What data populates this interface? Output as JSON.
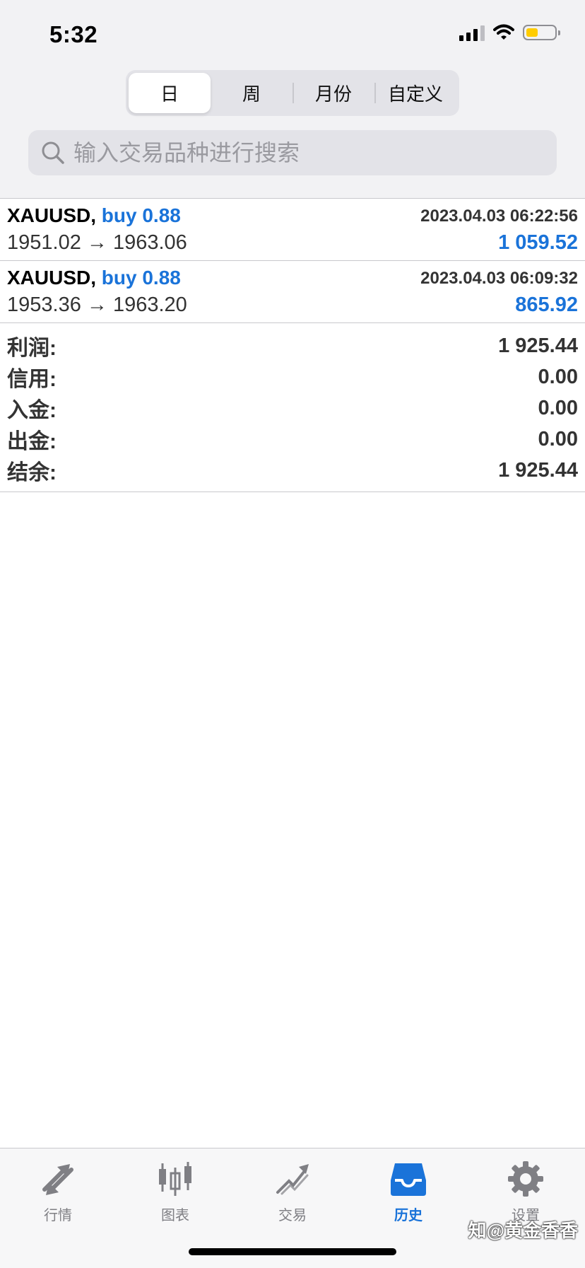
{
  "status_bar": {
    "time": "5:32"
  },
  "segments": [
    {
      "label": "日",
      "active": true
    },
    {
      "label": "周",
      "active": false
    },
    {
      "label": "月份",
      "active": false
    },
    {
      "label": "自定义",
      "active": false
    }
  ],
  "search": {
    "placeholder": "输入交易品种进行搜索"
  },
  "trades": [
    {
      "symbol": "XAUUSD,",
      "direction": "buy 0.88",
      "timestamp": "2023.04.03 06:22:56",
      "prices": "1951.02 → 1963.06",
      "profit": "1 059.52"
    },
    {
      "symbol": "XAUUSD,",
      "direction": "buy 0.88",
      "timestamp": "2023.04.03 06:09:32",
      "prices": "1953.36 → 1963.20",
      "profit": "865.92"
    }
  ],
  "summary": {
    "profit": {
      "label": "利润:",
      "value": "1 925.44"
    },
    "credit": {
      "label": "信用:",
      "value": "0.00"
    },
    "deposit": {
      "label": "入金:",
      "value": "0.00"
    },
    "withdrawal": {
      "label": "出金:",
      "value": "0.00"
    },
    "balance": {
      "label": "结余:",
      "value": "1 925.44"
    }
  },
  "tabs": [
    {
      "label": "行情",
      "icon": "quotes-arrows-icon"
    },
    {
      "label": "图表",
      "icon": "candlestick-chart-icon"
    },
    {
      "label": "交易",
      "icon": "trade-trend-icon"
    },
    {
      "label": "历史",
      "icon": "history-inbox-icon",
      "active": true
    },
    {
      "label": "设置",
      "icon": "gear-icon"
    }
  ],
  "watermark": "知@黄金香香",
  "colors": {
    "accent": "#1a73d9",
    "battery": "#ffcc00",
    "text_secondary": "#333333"
  }
}
